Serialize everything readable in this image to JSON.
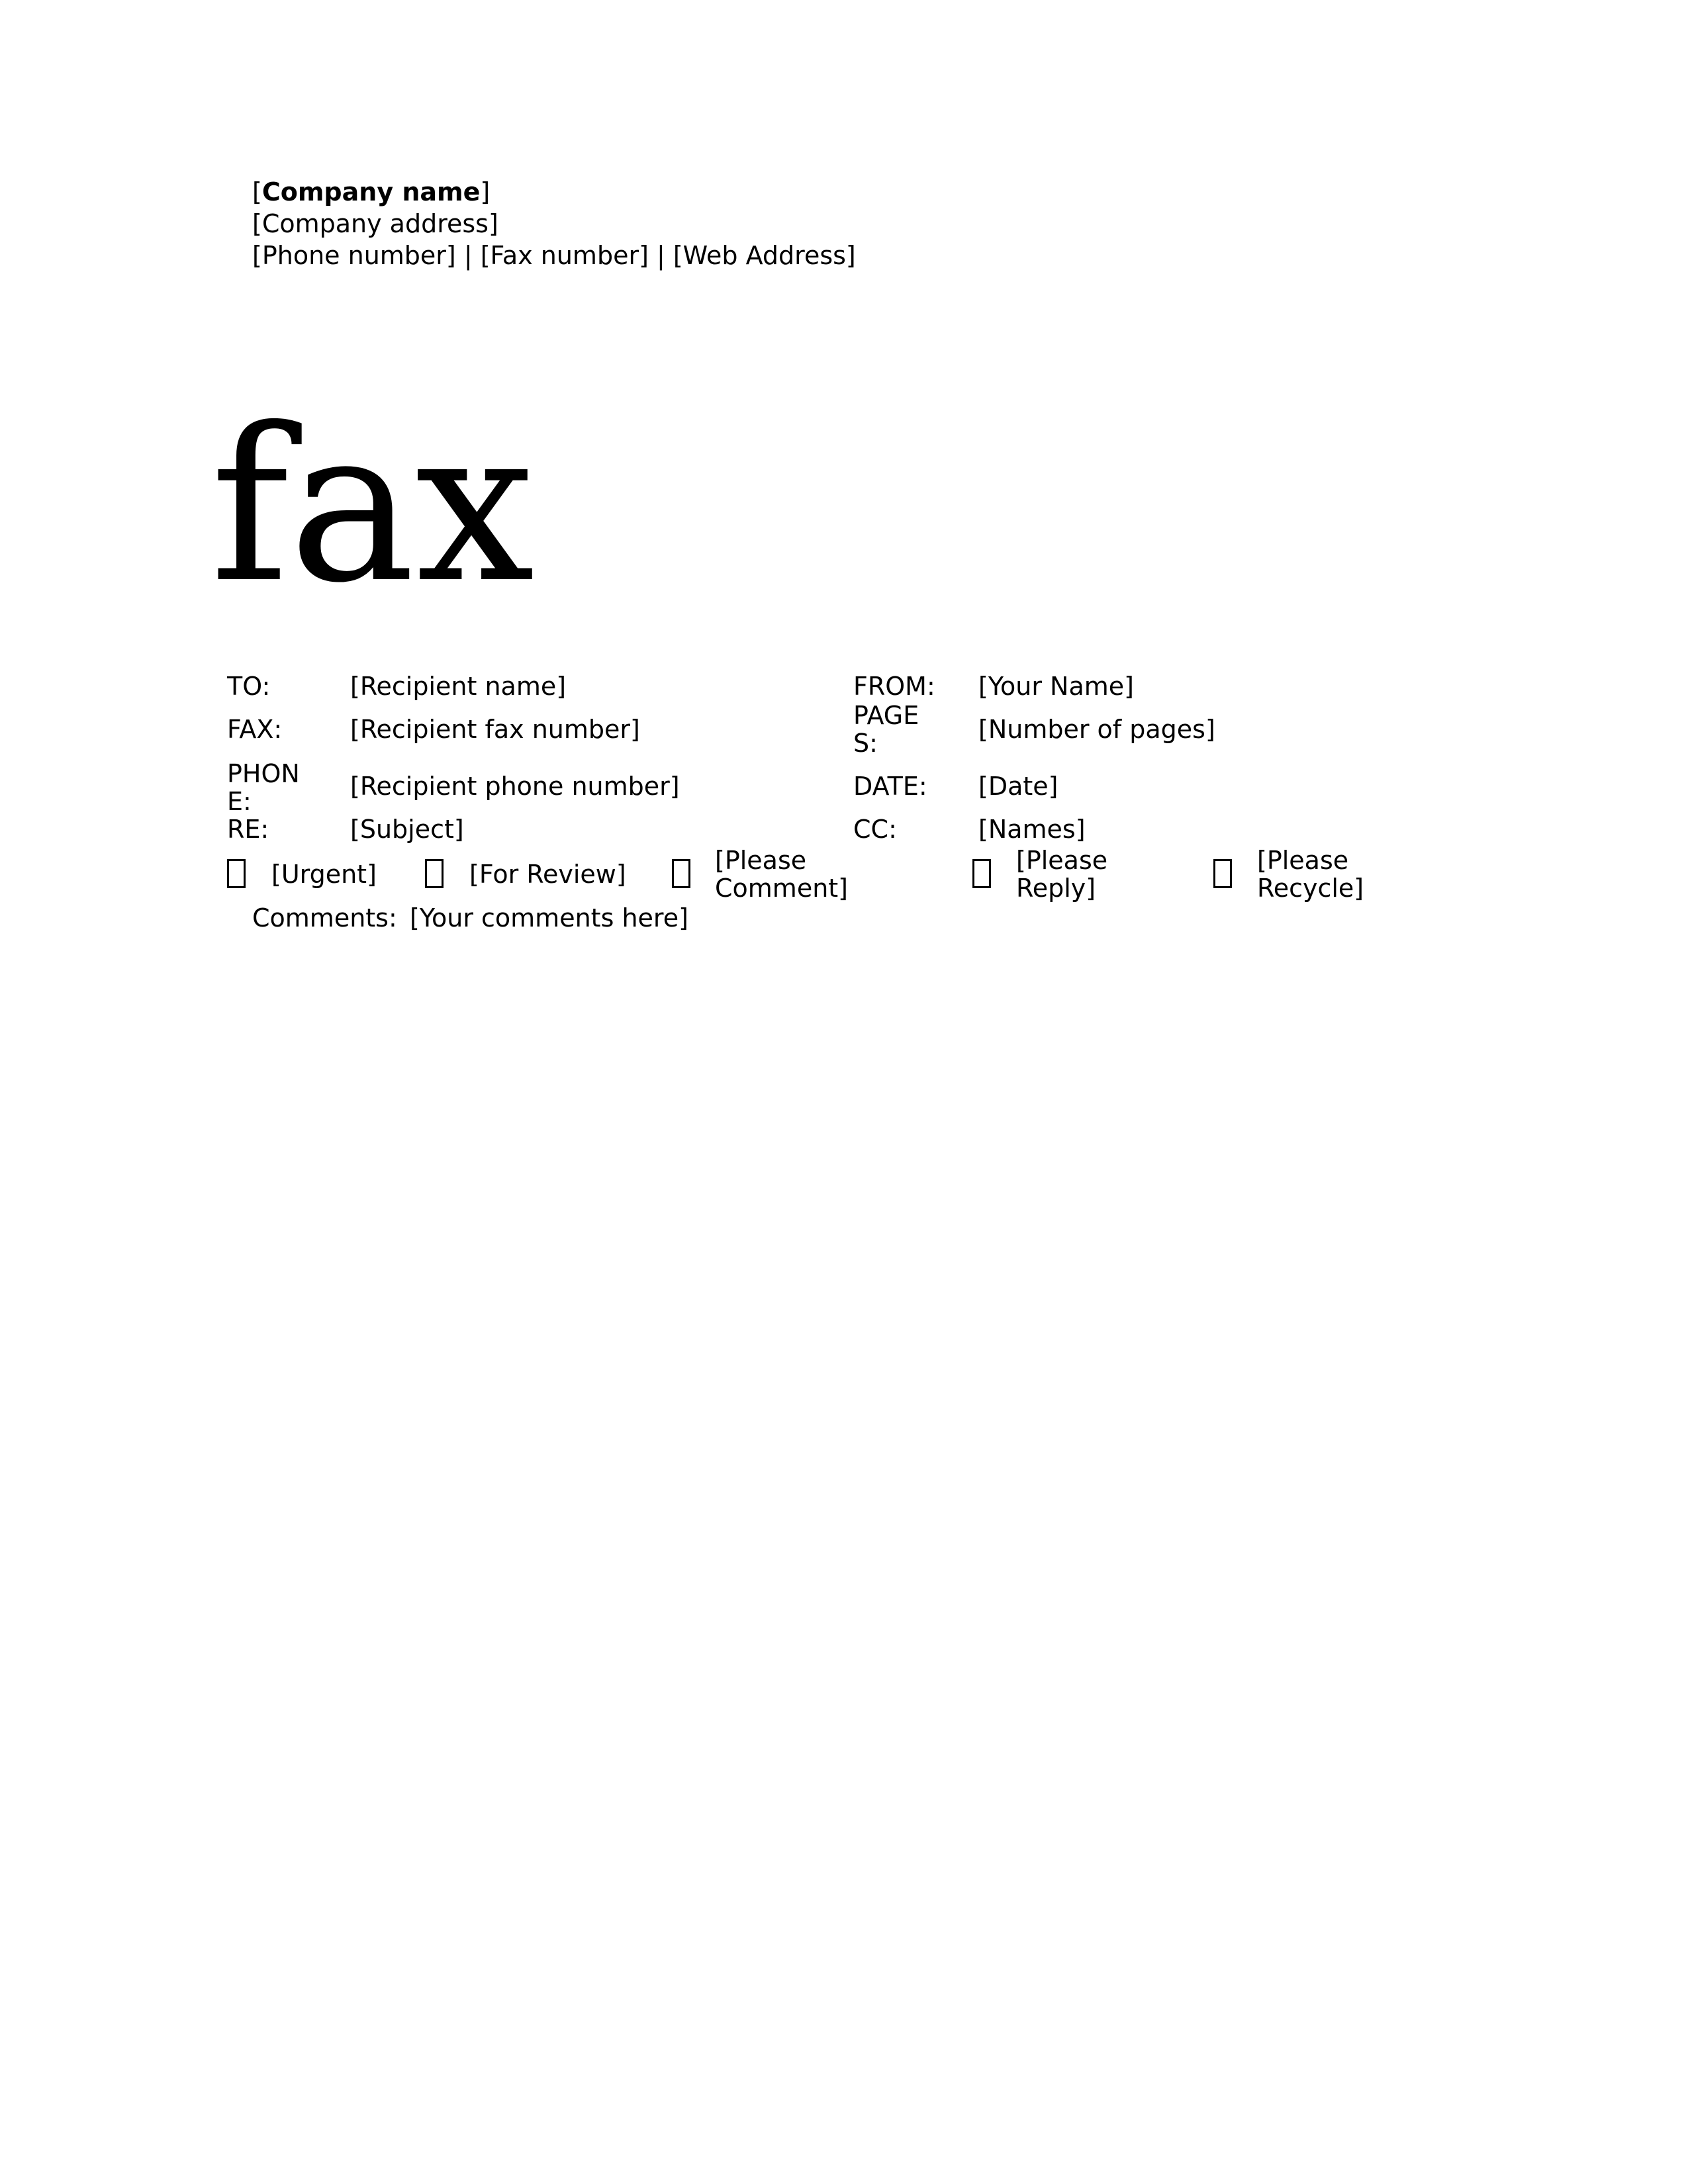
{
  "company": {
    "name": "Company name",
    "address": "[Company address]",
    "contact_line": "[Phone number] | [Fax number] | [Web Address]"
  },
  "title": "fax",
  "left_fields": {
    "to_label": "TO:",
    "to_value": "[Recipient name]",
    "fax_label": "FAX:",
    "fax_value": "[Recipient fax number]",
    "phone_label": "PHONE:",
    "phone_value": "[Recipient phone number]",
    "re_label": "RE:",
    "re_value": "[Subject]"
  },
  "right_fields": {
    "from_label": "FROM:",
    "from_value": "[Your Name]",
    "pages_label": "PAGES:",
    "pages_value": "[Number of pages]",
    "date_label": "DATE:",
    "date_value": "[Date]",
    "cc_label": "CC:",
    "cc_value": "[Names]"
  },
  "checkboxes": [
    {
      "label": "[Urgent]",
      "checked": false
    },
    {
      "label": "[For Review]",
      "checked": false
    },
    {
      "label": "[Please Comment]",
      "checked": false
    },
    {
      "label": "[Please Reply]",
      "checked": false
    },
    {
      "label": "[Please Recycle]",
      "checked": false
    }
  ],
  "comments": {
    "label": "Comments:",
    "value": "[Your comments here]"
  }
}
